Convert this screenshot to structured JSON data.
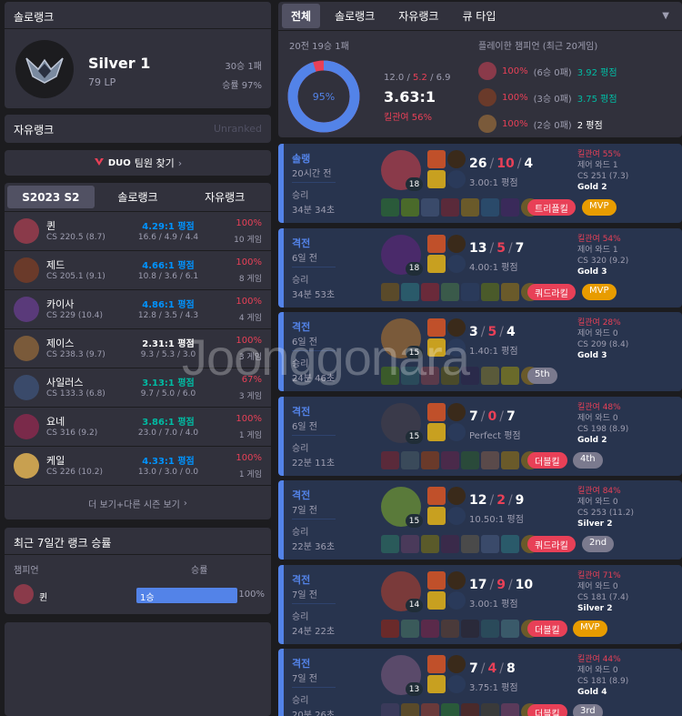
{
  "solo": {
    "title": "솔로랭크",
    "tier": "Silver 1",
    "lp": "79 LP",
    "record": "30승 1패",
    "winrate": "승률 97%"
  },
  "flex": {
    "title": "자유랭크",
    "status": "Unranked"
  },
  "duo": {
    "logo": "DUO",
    "label": "팀원 찾기"
  },
  "season": {
    "tabs": [
      "S2023 S2",
      "솔로랭크",
      "자유랭크"
    ],
    "champions": [
      {
        "name": "퀸",
        "cs": "CS 220.5 (8.7)",
        "ratio": "4.29:1 평점",
        "kda": "16.6 / 4.9 / 4.4",
        "wr": "100%",
        "games": "10 게임",
        "ratio_color": "#0093ff",
        "wr_color": "#e84057",
        "color": "#8a3a4a"
      },
      {
        "name": "제드",
        "cs": "CS 205.1 (9.1)",
        "ratio": "4.66:1 평점",
        "kda": "10.8 / 3.6 / 6.1",
        "wr": "100%",
        "games": "8 게임",
        "ratio_color": "#0093ff",
        "wr_color": "#e84057",
        "color": "#6a3a2a"
      },
      {
        "name": "카이사",
        "cs": "CS 229 (10.4)",
        "ratio": "4.86:1 평점",
        "kda": "12.8 / 3.5 / 4.3",
        "wr": "100%",
        "games": "4 게임",
        "ratio_color": "#0093ff",
        "wr_color": "#e84057",
        "color": "#5a3a7a"
      },
      {
        "name": "제이스",
        "cs": "CS 238.3 (9.7)",
        "ratio": "2.31:1 평점",
        "kda": "9.3 / 5.3 / 3.0",
        "wr": "100%",
        "games": "3 게임",
        "ratio_color": "#ffffff",
        "wr_color": "#e84057",
        "color": "#7a5a3a"
      },
      {
        "name": "사일러스",
        "cs": "CS 133.3 (6.8)",
        "ratio": "3.13:1 평점",
        "kda": "9.7 / 5.0 / 6.0",
        "wr": "67%",
        "games": "3 게임",
        "ratio_color": "#00bba3",
        "wr_color": "#e84057",
        "color": "#3a4a6a"
      },
      {
        "name": "요네",
        "cs": "CS 316 (9.2)",
        "ratio": "3.86:1 평점",
        "kda": "23.0 / 7.0 / 4.0",
        "wr": "100%",
        "games": "1 게임",
        "ratio_color": "#00bba3",
        "wr_color": "#e84057",
        "color": "#7a2a4a"
      },
      {
        "name": "케일",
        "cs": "CS 226 (10.2)",
        "ratio": "4.33:1 평점",
        "kda": "13.0 / 3.0 / 0.0",
        "wr": "100%",
        "games": "1 게임",
        "ratio_color": "#0093ff",
        "wr_color": "#e84057",
        "color": "#c8a050"
      }
    ],
    "more": "더 보기+다른 시즌 보기"
  },
  "recent": {
    "title": "최근 7일간 랭크 승률",
    "col_champion": "챔피언",
    "col_winrate": "승률",
    "rows": [
      {
        "name": "퀸",
        "wins": "1승",
        "pct": "100%",
        "fill": 1.0
      }
    ]
  },
  "summary": {
    "tabs": [
      "전체",
      "솔로랭크",
      "자유랭크",
      "큐 타입"
    ],
    "record": "20전 19승 1패",
    "winrate_label": "95%",
    "win_fraction": 0.95,
    "kda_k": "12.0",
    "kda_d": "5.2",
    "kda_a": "6.9",
    "ratio": "3.63:1",
    "kill_part": "킬관여 56%",
    "played_title": "플레이한 챔피언 (최근 20게임)",
    "played": [
      {
        "pct": "100%",
        "wl": "(6승 0패)",
        "score": "3.92 평점",
        "score_color": "#00bba3",
        "color": "#8a3a4a"
      },
      {
        "pct": "100%",
        "wl": "(3승 0패)",
        "score": "3.75 평점",
        "score_color": "#00bba3",
        "color": "#6a3a2a"
      },
      {
        "pct": "100%",
        "wl": "(2승 0패)",
        "score": "2 평점",
        "score_color": "#ffffff",
        "color": "#7a5a3a"
      }
    ]
  },
  "matches": [
    {
      "queue": "솔랭",
      "time": "20시간 전",
      "result": "승리",
      "duration": "34분 34초",
      "level": "18",
      "k": "26",
      "d": "10",
      "a": "4",
      "ratio": "3.00:1 평점",
      "kp": "킬관여 55%",
      "wards": "제어 와드 1",
      "cs": "CS 251 (7.3)",
      "tier": "Gold 2",
      "badge": "트리플킬",
      "badge2": "MVP",
      "badge2_class": "bmvp",
      "avatar": "#8a3a4a",
      "items": [
        "#2a5a3a",
        "#4a6a2a",
        "#3a4a6a",
        "#5a2a3a",
        "#6a5a2a",
        "#2a4a6a",
        "#3a2a5a"
      ]
    },
    {
      "queue": "격전",
      "time": "6일 전",
      "result": "승리",
      "duration": "34분 53초",
      "level": "18",
      "k": "13",
      "d": "5",
      "a": "7",
      "ratio": "4.00:1 평점",
      "kp": "킬관여 54%",
      "wards": "제어 와드 1",
      "cs": "CS 320 (9.2)",
      "tier": "Gold 3",
      "badge": "쿼드라킬",
      "badge2": "MVP",
      "badge2_class": "bmvp",
      "avatar": "#4a2a6a",
      "items": [
        "#5a4a2a",
        "#2a5a6a",
        "#6a2a3a",
        "#3a5a4a",
        "#2a3a5a",
        "#4a5a2a",
        "#6a5a2a"
      ]
    },
    {
      "queue": "격전",
      "time": "6일 전",
      "result": "승리",
      "duration": "24분 46초",
      "level": "15",
      "k": "3",
      "d": "5",
      "a": "4",
      "ratio": "1.40:1 평점",
      "kp": "킬관여 28%",
      "wards": "제어 와드 0",
      "cs": "CS 209 (8.4)",
      "tier": "Gold 3",
      "badge": "",
      "badge2": "5th",
      "badge2_class": "brank",
      "avatar": "#7a5a3a",
      "items": [
        "#3a5a2a",
        "#2a4a5a",
        "#5a3a4a",
        "#4a4a2a",
        "#2a2a4a",
        "#5a5a3a",
        "#6a6a2a"
      ]
    },
    {
      "queue": "격전",
      "time": "6일 전",
      "result": "승리",
      "duration": "22분 11초",
      "level": "15",
      "k": "7",
      "d": "0",
      "a": "7",
      "ratio": "Perfect 평점",
      "kp": "킬관여 48%",
      "wards": "제어 와드 0",
      "cs": "CS 198 (8.9)",
      "tier": "Gold 2",
      "badge": "더블킬",
      "badge2": "4th",
      "badge2_class": "brank",
      "avatar": "#3a3a4a",
      "items": [
        "#5a2a3a",
        "#3a4a5a",
        "#6a3a2a",
        "#4a2a4a",
        "#2a4a3a",
        "#5a4a4a",
        "#6a5a2a"
      ]
    },
    {
      "queue": "격전",
      "time": "7일 전",
      "result": "승리",
      "duration": "22분 36초",
      "level": "15",
      "k": "12",
      "d": "2",
      "a": "9",
      "ratio": "10.50:1 평점",
      "kp": "킬관여 84%",
      "wards": "제어 와드 0",
      "cs": "CS 253 (11.2)",
      "tier": "Silver 2",
      "badge": "쿼드라킬",
      "badge2": "2nd",
      "badge2_class": "brank",
      "avatar": "#5a7a3a",
      "items": [
        "#2a5a5a",
        "#4a3a5a",
        "#5a5a2a",
        "#3a2a4a",
        "#4a4a4a",
        "#3a4a6a",
        "#2a5a6a"
      ]
    },
    {
      "queue": "격전",
      "time": "7일 전",
      "result": "승리",
      "duration": "24분 22초",
      "level": "14",
      "k": "17",
      "d": "9",
      "a": "10",
      "ratio": "3.00:1 평점",
      "kp": "킬관여 71%",
      "wards": "제어 와드 0",
      "cs": "CS 181 (7.4)",
      "tier": "Silver 2",
      "badge": "더블킬",
      "badge2": "MVP",
      "badge2_class": "bmvp",
      "avatar": "#7a3a3a",
      "items": [
        "#6a2a2a",
        "#3a5a5a",
        "#5a2a4a",
        "#4a3a3a",
        "#2a2a3a",
        "#2a4a5a",
        "#3a5a6a"
      ]
    },
    {
      "queue": "격전",
      "time": "7일 전",
      "result": "승리",
      "duration": "20분 26초",
      "level": "13",
      "k": "7",
      "d": "4",
      "a": "8",
      "ratio": "3.75:1 평점",
      "kp": "킬관여 44%",
      "wards": "제어 와드 0",
      "cs": "CS 181 (8.9)",
      "tier": "Gold 4",
      "badge": "더블킬",
      "badge2": "3rd",
      "badge2_class": "brank",
      "avatar": "#5a4a6a",
      "items": [
        "#3a3a5a",
        "#5a4a2a",
        "#6a3a3a",
        "#2a5a3a",
        "#4a2a2a",
        "#3a3a3a",
        "#5a3a5a"
      ]
    }
  ],
  "watermark": "Joonggonara"
}
